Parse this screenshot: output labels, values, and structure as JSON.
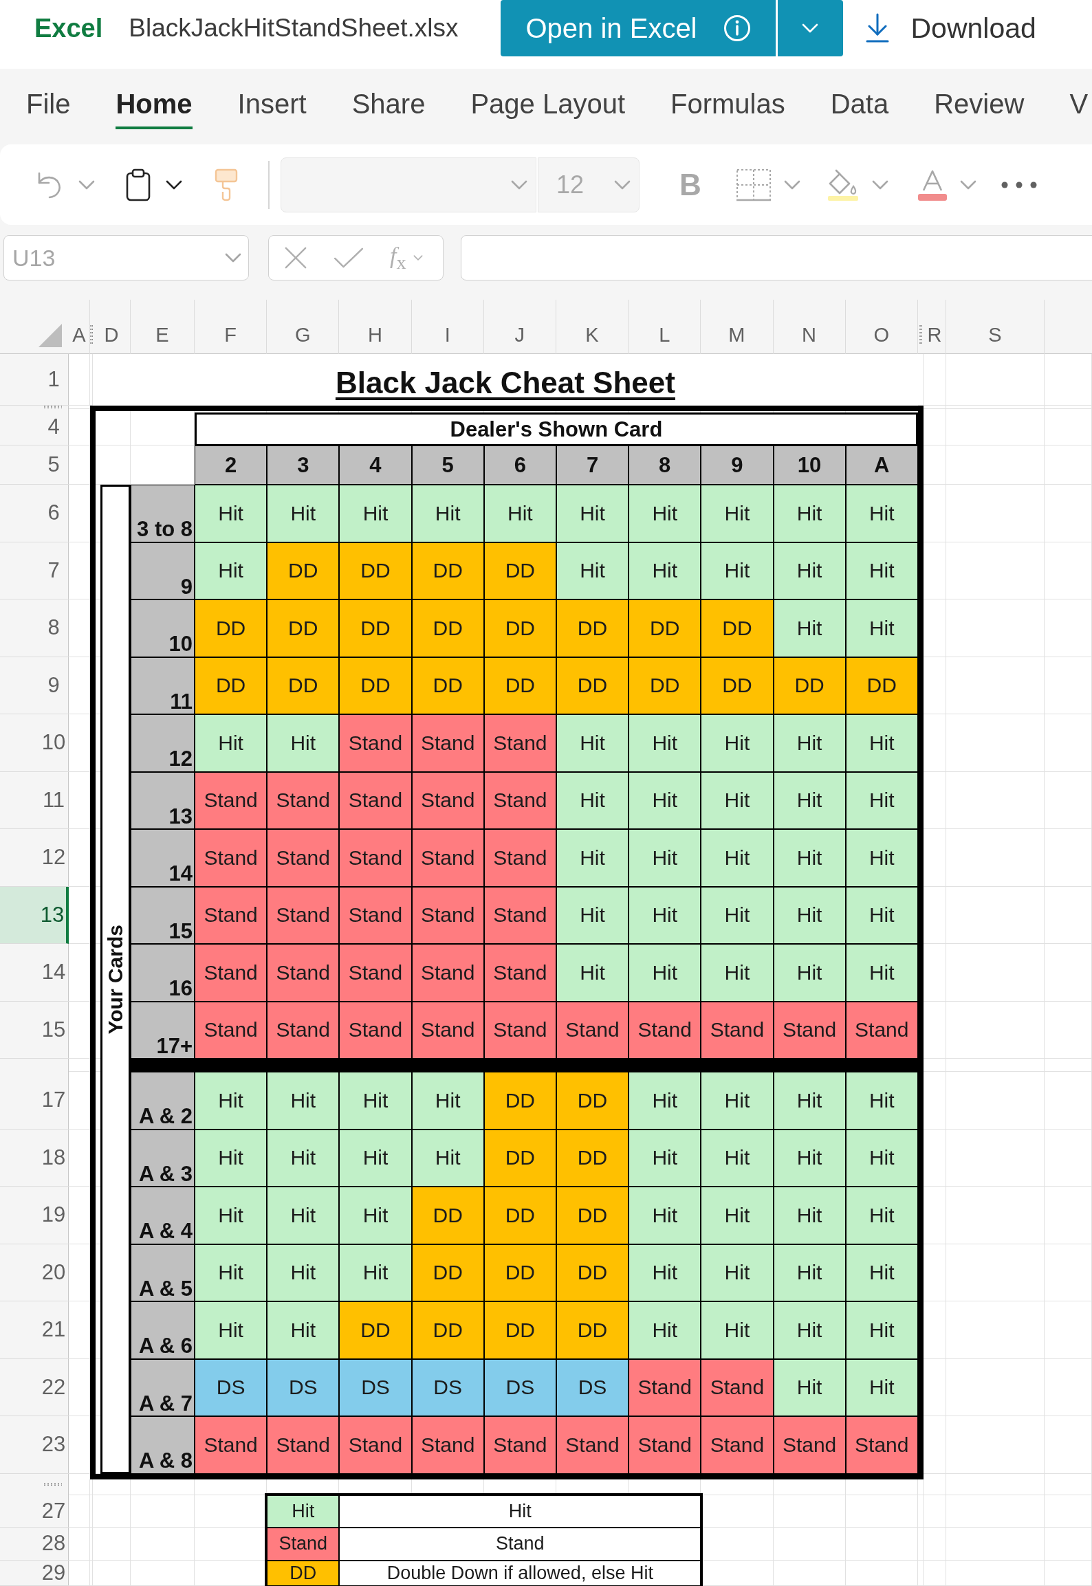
{
  "app_bar": {
    "app_name": "Excel",
    "file_name": "BlackJackHitStandSheet.xlsx",
    "open_button": "Open in Excel",
    "download_button": "Download"
  },
  "ribbon_tabs": [
    {
      "label": "File",
      "selected": false
    },
    {
      "label": "Home",
      "selected": true
    },
    {
      "label": "Insert",
      "selected": false
    },
    {
      "label": "Share",
      "selected": false
    },
    {
      "label": "Page Layout",
      "selected": false
    },
    {
      "label": "Formulas",
      "selected": false
    },
    {
      "label": "Data",
      "selected": false
    },
    {
      "label": "Review",
      "selected": false
    },
    {
      "label": "V",
      "selected": false
    }
  ],
  "toolbar": [
    {
      "kind": "undo",
      "disabled": true
    },
    {
      "kind": "paste",
      "disabled": false
    },
    {
      "kind": "format_painter",
      "disabled": true
    },
    {
      "kind": "font_name",
      "disabled": true
    },
    {
      "kind": "font_size",
      "value": "12",
      "disabled": true
    },
    {
      "kind": "bold",
      "label": "B",
      "disabled": true
    },
    {
      "kind": "borders",
      "disabled": true
    },
    {
      "kind": "fill_color",
      "disabled": true
    },
    {
      "kind": "font_color",
      "disabled": true
    },
    {
      "kind": "more",
      "disabled": false
    }
  ],
  "formula_bar": {
    "name_box": "U13",
    "function_button": "*f*$_{x}$"
  },
  "sheet": {
    "column_headers": [
      {
        "kind": "column",
        "label": "A"
      },
      {
        "kind": "hidden"
      },
      {
        "kind": "column",
        "label": "D"
      },
      {
        "kind": "column",
        "label": "E"
      },
      {
        "kind": "column",
        "label": "F"
      },
      {
        "kind": "column",
        "label": "G"
      },
      {
        "kind": "column",
        "label": "H"
      },
      {
        "kind": "column",
        "label": "I"
      },
      {
        "kind": "column",
        "label": "J"
      },
      {
        "kind": "column",
        "label": "K"
      },
      {
        "kind": "column",
        "label": "L"
      },
      {
        "kind": "column",
        "label": "M"
      },
      {
        "kind": "column",
        "label": "N"
      },
      {
        "kind": "column",
        "label": "O"
      },
      {
        "kind": "hidden"
      },
      {
        "kind": "column",
        "label": "R"
      },
      {
        "kind": "column",
        "label": "S"
      }
    ],
    "row_headers": [
      {
        "kind": "row",
        "label": "1",
        "selected": false
      },
      {
        "kind": "hidden"
      },
      {
        "kind": "row",
        "label": "4",
        "selected": false
      },
      {
        "kind": "row",
        "label": "5",
        "selected": false
      },
      {
        "kind": "row",
        "label": "6",
        "selected": false
      },
      {
        "kind": "row",
        "label": "7",
        "selected": false
      },
      {
        "kind": "row",
        "label": "8",
        "selected": false
      },
      {
        "kind": "row",
        "label": "9",
        "selected": false
      },
      {
        "kind": "row",
        "label": "10",
        "selected": false
      },
      {
        "kind": "row",
        "label": "11",
        "selected": false
      },
      {
        "kind": "row",
        "label": "12",
        "selected": false
      },
      {
        "kind": "row",
        "label": "13",
        "selected": true
      },
      {
        "kind": "row",
        "label": "14",
        "selected": false
      },
      {
        "kind": "row",
        "label": "15",
        "selected": false
      },
      {
        "kind": "spacer"
      },
      {
        "kind": "row",
        "label": "17",
        "selected": false
      },
      {
        "kind": "row",
        "label": "18",
        "selected": false
      },
      {
        "kind": "row",
        "label": "19",
        "selected": false
      },
      {
        "kind": "row",
        "label": "20",
        "selected": false
      },
      {
        "kind": "row",
        "label": "21",
        "selected": false
      },
      {
        "kind": "row",
        "label": "22",
        "selected": false
      },
      {
        "kind": "row",
        "label": "23",
        "selected": false
      },
      {
        "kind": "hidden"
      },
      {
        "kind": "row",
        "label": "27",
        "selected": false
      },
      {
        "kind": "row",
        "label": "28",
        "selected": false
      },
      {
        "kind": "row",
        "label": "29",
        "selected": false
      }
    ]
  },
  "cheat_sheet": {
    "title": "Black Jack Cheat Sheet",
    "dealer_heading": "Dealer's Shown Card",
    "dealer_cards": [
      "2",
      "3",
      "4",
      "5",
      "6",
      "7",
      "8",
      "9",
      "10",
      "A"
    ],
    "player_heading": "Your Cards",
    "hard_hands": [
      {
        "hand": "3 to 8",
        "cells": [
          {
            "text": "Hit",
            "color": "#c1f0c8"
          },
          {
            "text": "Hit",
            "color": "#c1f0c8"
          },
          {
            "text": "Hit",
            "color": "#c1f0c8"
          },
          {
            "text": "Hit",
            "color": "#c1f0c8"
          },
          {
            "text": "Hit",
            "color": "#c1f0c8"
          },
          {
            "text": "Hit",
            "color": "#c1f0c8"
          },
          {
            "text": "Hit",
            "color": "#c1f0c8"
          },
          {
            "text": "Hit",
            "color": "#c1f0c8"
          },
          {
            "text": "Hit",
            "color": "#c1f0c8"
          },
          {
            "text": "Hit",
            "color": "#c1f0c8"
          }
        ]
      },
      {
        "hand": "9",
        "cells": [
          {
            "text": "Hit",
            "color": "#c1f0c8"
          },
          {
            "text": "DD",
            "color": "#ffc000"
          },
          {
            "text": "DD",
            "color": "#ffc000"
          },
          {
            "text": "DD",
            "color": "#ffc000"
          },
          {
            "text": "DD",
            "color": "#ffc000"
          },
          {
            "text": "Hit",
            "color": "#c1f0c8"
          },
          {
            "text": "Hit",
            "color": "#c1f0c8"
          },
          {
            "text": "Hit",
            "color": "#c1f0c8"
          },
          {
            "text": "Hit",
            "color": "#c1f0c8"
          },
          {
            "text": "Hit",
            "color": "#c1f0c8"
          }
        ]
      },
      {
        "hand": "10",
        "cells": [
          {
            "text": "DD",
            "color": "#ffc000"
          },
          {
            "text": "DD",
            "color": "#ffc000"
          },
          {
            "text": "DD",
            "color": "#ffc000"
          },
          {
            "text": "DD",
            "color": "#ffc000"
          },
          {
            "text": "DD",
            "color": "#ffc000"
          },
          {
            "text": "DD",
            "color": "#ffc000"
          },
          {
            "text": "DD",
            "color": "#ffc000"
          },
          {
            "text": "DD",
            "color": "#ffc000"
          },
          {
            "text": "Hit",
            "color": "#c1f0c8"
          },
          {
            "text": "Hit",
            "color": "#c1f0c8"
          }
        ]
      },
      {
        "hand": "11",
        "cells": [
          {
            "text": "DD",
            "color": "#ffc000"
          },
          {
            "text": "DD",
            "color": "#ffc000"
          },
          {
            "text": "DD",
            "color": "#ffc000"
          },
          {
            "text": "DD",
            "color": "#ffc000"
          },
          {
            "text": "DD",
            "color": "#ffc000"
          },
          {
            "text": "DD",
            "color": "#ffc000"
          },
          {
            "text": "DD",
            "color": "#ffc000"
          },
          {
            "text": "DD",
            "color": "#ffc000"
          },
          {
            "text": "DD",
            "color": "#ffc000"
          },
          {
            "text": "DD",
            "color": "#ffc000"
          }
        ]
      },
      {
        "hand": "12",
        "cells": [
          {
            "text": "Hit",
            "color": "#c1f0c8"
          },
          {
            "text": "Hit",
            "color": "#c1f0c8"
          },
          {
            "text": "Stand",
            "color": "#ff7c80"
          },
          {
            "text": "Stand",
            "color": "#ff7c80"
          },
          {
            "text": "Stand",
            "color": "#ff7c80"
          },
          {
            "text": "Hit",
            "color": "#c1f0c8"
          },
          {
            "text": "Hit",
            "color": "#c1f0c8"
          },
          {
            "text": "Hit",
            "color": "#c1f0c8"
          },
          {
            "text": "Hit",
            "color": "#c1f0c8"
          },
          {
            "text": "Hit",
            "color": "#c1f0c8"
          }
        ]
      },
      {
        "hand": "13",
        "cells": [
          {
            "text": "Stand",
            "color": "#ff7c80"
          },
          {
            "text": "Stand",
            "color": "#ff7c80"
          },
          {
            "text": "Stand",
            "color": "#ff7c80"
          },
          {
            "text": "Stand",
            "color": "#ff7c80"
          },
          {
            "text": "Stand",
            "color": "#ff7c80"
          },
          {
            "text": "Hit",
            "color": "#c1f0c8"
          },
          {
            "text": "Hit",
            "color": "#c1f0c8"
          },
          {
            "text": "Hit",
            "color": "#c1f0c8"
          },
          {
            "text": "Hit",
            "color": "#c1f0c8"
          },
          {
            "text": "Hit",
            "color": "#c1f0c8"
          }
        ]
      },
      {
        "hand": "14",
        "cells": [
          {
            "text": "Stand",
            "color": "#ff7c80"
          },
          {
            "text": "Stand",
            "color": "#ff7c80"
          },
          {
            "text": "Stand",
            "color": "#ff7c80"
          },
          {
            "text": "Stand",
            "color": "#ff7c80"
          },
          {
            "text": "Stand",
            "color": "#ff7c80"
          },
          {
            "text": "Hit",
            "color": "#c1f0c8"
          },
          {
            "text": "Hit",
            "color": "#c1f0c8"
          },
          {
            "text": "Hit",
            "color": "#c1f0c8"
          },
          {
            "text": "Hit",
            "color": "#c1f0c8"
          },
          {
            "text": "Hit",
            "color": "#c1f0c8"
          }
        ]
      },
      {
        "hand": "15",
        "cells": [
          {
            "text": "Stand",
            "color": "#ff7c80"
          },
          {
            "text": "Stand",
            "color": "#ff7c80"
          },
          {
            "text": "Stand",
            "color": "#ff7c80"
          },
          {
            "text": "Stand",
            "color": "#ff7c80"
          },
          {
            "text": "Stand",
            "color": "#ff7c80"
          },
          {
            "text": "Hit",
            "color": "#c1f0c8"
          },
          {
            "text": "Hit",
            "color": "#c1f0c8"
          },
          {
            "text": "Hit",
            "color": "#c1f0c8"
          },
          {
            "text": "Hit",
            "color": "#c1f0c8"
          },
          {
            "text": "Hit",
            "color": "#c1f0c8"
          }
        ]
      },
      {
        "hand": "16",
        "cells": [
          {
            "text": "Stand",
            "color": "#ff7c80"
          },
          {
            "text": "Stand",
            "color": "#ff7c80"
          },
          {
            "text": "Stand",
            "color": "#ff7c80"
          },
          {
            "text": "Stand",
            "color": "#ff7c80"
          },
          {
            "text": "Stand",
            "color": "#ff7c80"
          },
          {
            "text": "Hit",
            "color": "#c1f0c8"
          },
          {
            "text": "Hit",
            "color": "#c1f0c8"
          },
          {
            "text": "Hit",
            "color": "#c1f0c8"
          },
          {
            "text": "Hit",
            "color": "#c1f0c8"
          },
          {
            "text": "Hit",
            "color": "#c1f0c8"
          }
        ]
      },
      {
        "hand": "17+",
        "cells": [
          {
            "text": "Stand",
            "color": "#ff7c80"
          },
          {
            "text": "Stand",
            "color": "#ff7c80"
          },
          {
            "text": "Stand",
            "color": "#ff7c80"
          },
          {
            "text": "Stand",
            "color": "#ff7c80"
          },
          {
            "text": "Stand",
            "color": "#ff7c80"
          },
          {
            "text": "Stand",
            "color": "#ff7c80"
          },
          {
            "text": "Stand",
            "color": "#ff7c80"
          },
          {
            "text": "Stand",
            "color": "#ff7c80"
          },
          {
            "text": "Stand",
            "color": "#ff7c80"
          },
          {
            "text": "Stand",
            "color": "#ff7c80"
          }
        ]
      }
    ],
    "soft_hands": [
      {
        "hand": "A & 2",
        "cells": [
          {
            "text": "Hit",
            "color": "#c1f0c8"
          },
          {
            "text": "Hit",
            "color": "#c1f0c8"
          },
          {
            "text": "Hit",
            "color": "#c1f0c8"
          },
          {
            "text": "Hit",
            "color": "#c1f0c8"
          },
          {
            "text": "DD",
            "color": "#ffc000"
          },
          {
            "text": "DD",
            "color": "#ffc000"
          },
          {
            "text": "Hit",
            "color": "#c1f0c8"
          },
          {
            "text": "Hit",
            "color": "#c1f0c8"
          },
          {
            "text": "Hit",
            "color": "#c1f0c8"
          },
          {
            "text": "Hit",
            "color": "#c1f0c8"
          }
        ]
      },
      {
        "hand": "A & 3",
        "cells": [
          {
            "text": "Hit",
            "color": "#c1f0c8"
          },
          {
            "text": "Hit",
            "color": "#c1f0c8"
          },
          {
            "text": "Hit",
            "color": "#c1f0c8"
          },
          {
            "text": "Hit",
            "color": "#c1f0c8"
          },
          {
            "text": "DD",
            "color": "#ffc000"
          },
          {
            "text": "DD",
            "color": "#ffc000"
          },
          {
            "text": "Hit",
            "color": "#c1f0c8"
          },
          {
            "text": "Hit",
            "color": "#c1f0c8"
          },
          {
            "text": "Hit",
            "color": "#c1f0c8"
          },
          {
            "text": "Hit",
            "color": "#c1f0c8"
          }
        ]
      },
      {
        "hand": "A & 4",
        "cells": [
          {
            "text": "Hit",
            "color": "#c1f0c8"
          },
          {
            "text": "Hit",
            "color": "#c1f0c8"
          },
          {
            "text": "Hit",
            "color": "#c1f0c8"
          },
          {
            "text": "DD",
            "color": "#ffc000"
          },
          {
            "text": "DD",
            "color": "#ffc000"
          },
          {
            "text": "DD",
            "color": "#ffc000"
          },
          {
            "text": "Hit",
            "color": "#c1f0c8"
          },
          {
            "text": "Hit",
            "color": "#c1f0c8"
          },
          {
            "text": "Hit",
            "color": "#c1f0c8"
          },
          {
            "text": "Hit",
            "color": "#c1f0c8"
          }
        ]
      },
      {
        "hand": "A & 5",
        "cells": [
          {
            "text": "Hit",
            "color": "#c1f0c8"
          },
          {
            "text": "Hit",
            "color": "#c1f0c8"
          },
          {
            "text": "Hit",
            "color": "#c1f0c8"
          },
          {
            "text": "DD",
            "color": "#ffc000"
          },
          {
            "text": "DD",
            "color": "#ffc000"
          },
          {
            "text": "DD",
            "color": "#ffc000"
          },
          {
            "text": "Hit",
            "color": "#c1f0c8"
          },
          {
            "text": "Hit",
            "color": "#c1f0c8"
          },
          {
            "text": "Hit",
            "color": "#c1f0c8"
          },
          {
            "text": "Hit",
            "color": "#c1f0c8"
          }
        ]
      },
      {
        "hand": "A & 6",
        "cells": [
          {
            "text": "Hit",
            "color": "#c1f0c8"
          },
          {
            "text": "Hit",
            "color": "#c1f0c8"
          },
          {
            "text": "DD",
            "color": "#ffc000"
          },
          {
            "text": "DD",
            "color": "#ffc000"
          },
          {
            "text": "DD",
            "color": "#ffc000"
          },
          {
            "text": "DD",
            "color": "#ffc000"
          },
          {
            "text": "Hit",
            "color": "#c1f0c8"
          },
          {
            "text": "Hit",
            "color": "#c1f0c8"
          },
          {
            "text": "Hit",
            "color": "#c1f0c8"
          },
          {
            "text": "Hit",
            "color": "#c1f0c8"
          }
        ]
      },
      {
        "hand": "A & 7",
        "cells": [
          {
            "text": "DS",
            "color": "#83cceb"
          },
          {
            "text": "DS",
            "color": "#83cceb"
          },
          {
            "text": "DS",
            "color": "#83cceb"
          },
          {
            "text": "DS",
            "color": "#83cceb"
          },
          {
            "text": "DS",
            "color": "#83cceb"
          },
          {
            "text": "DS",
            "color": "#83cceb"
          },
          {
            "text": "Stand",
            "color": "#ff7c80"
          },
          {
            "text": "Stand",
            "color": "#ff7c80"
          },
          {
            "text": "Hit",
            "color": "#c1f0c8"
          },
          {
            "text": "Hit",
            "color": "#c1f0c8"
          }
        ]
      },
      {
        "hand": "A & 8",
        "cells": [
          {
            "text": "Stand",
            "color": "#ff7c80"
          },
          {
            "text": "Stand",
            "color": "#ff7c80"
          },
          {
            "text": "Stand",
            "color": "#ff7c80"
          },
          {
            "text": "Stand",
            "color": "#ff7c80"
          },
          {
            "text": "Stand",
            "color": "#ff7c80"
          },
          {
            "text": "Stand",
            "color": "#ff7c80"
          },
          {
            "text": "Stand",
            "color": "#ff7c80"
          },
          {
            "text": "Stand",
            "color": "#ff7c80"
          },
          {
            "text": "Stand",
            "color": "#ff7c80"
          },
          {
            "text": "Stand",
            "color": "#ff7c80"
          }
        ]
      }
    ]
  },
  "legend": [
    {
      "key": "Hit",
      "color": "#c1f0c8",
      "meaning": "Hit"
    },
    {
      "key": "Stand",
      "color": "#ff7c80",
      "meaning": "Stand"
    },
    {
      "key": "DD",
      "color": "#ffc000",
      "meaning": "Double Down if allowed, else Hit"
    }
  ]
}
